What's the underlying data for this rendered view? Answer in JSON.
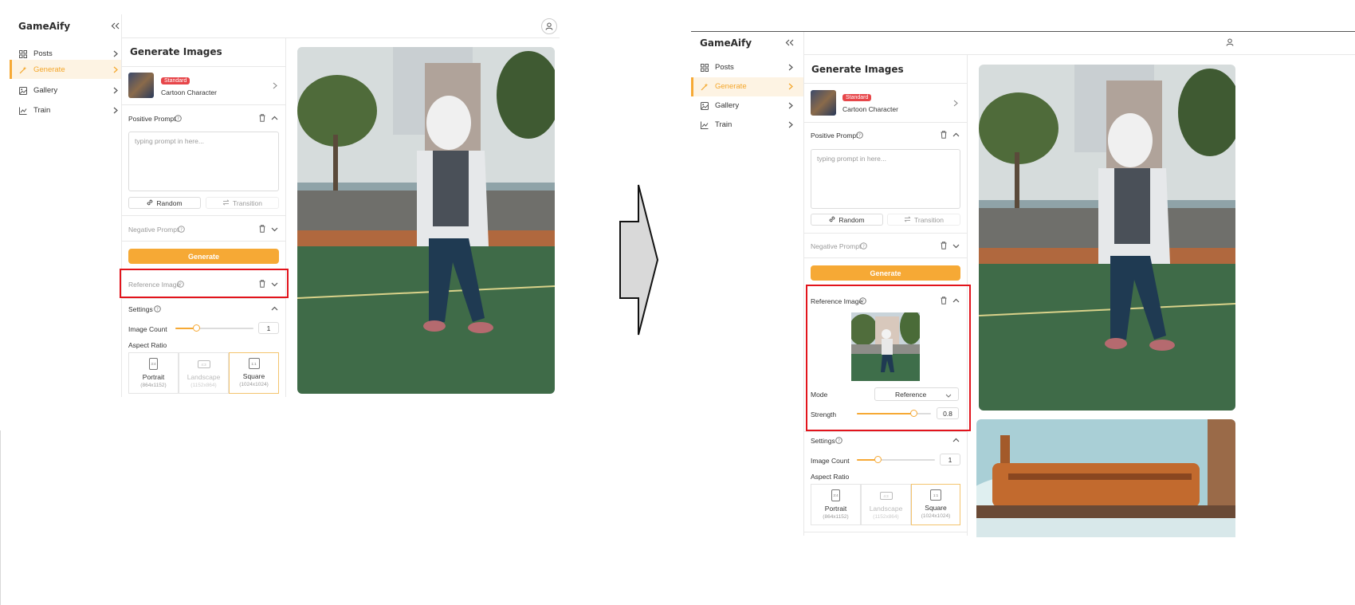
{
  "app": {
    "name": "GameAify"
  },
  "nav": {
    "items": [
      {
        "label": "Posts",
        "icon": "grid-icon"
      },
      {
        "label": "Generate",
        "icon": "wand-icon",
        "active": true
      },
      {
        "label": "Gallery",
        "icon": "image-icon"
      },
      {
        "label": "Train",
        "icon": "chart-icon"
      }
    ]
  },
  "panel": {
    "title": "Generate Images",
    "model": {
      "badge": "Standard",
      "name": "Cartoon Character"
    },
    "positive_prompt": {
      "label": "Positive Prompt",
      "placeholder": "typing prompt in here...",
      "random_label": "Random",
      "transition_label": "Transition"
    },
    "negative_prompt": {
      "label": "Negative Prompt"
    },
    "generate_label": "Generate",
    "reference_image": {
      "label": "Reference Image",
      "mode_label": "Mode",
      "mode_value": "Reference",
      "strength_label": "Strength",
      "strength_value": "0.8",
      "strength_fraction": 0.8
    },
    "settings": {
      "label": "Settings",
      "image_count_label": "Image Count",
      "image_count_value": "1",
      "image_count_fraction": 0.25,
      "aspect_ratio_label": "Aspect Ratio"
    },
    "ratios": [
      {
        "name": "Portrait",
        "size": "(864x1152)",
        "icon_text": "3:4"
      },
      {
        "name": "Landscape",
        "size": "(1152x864)",
        "icon_text": "4:3",
        "disabled": true
      },
      {
        "name": "Square",
        "size": "(1024x1024)",
        "icon_text": "1:1",
        "selected": true
      }
    ]
  },
  "colors": {
    "accent": "#f6a935",
    "badge": "#e7464a",
    "highlight": "#e2141c"
  }
}
